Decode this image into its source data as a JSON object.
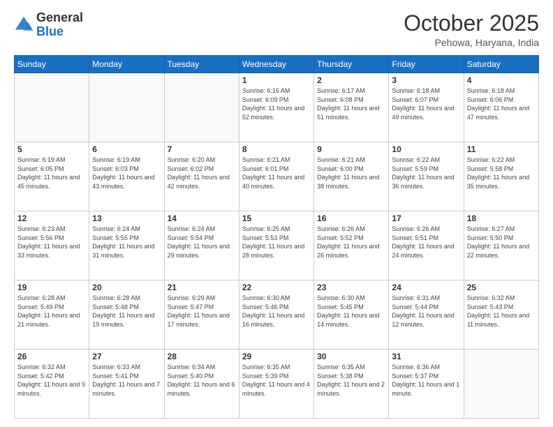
{
  "header": {
    "logo_general": "General",
    "logo_blue": "Blue",
    "month_title": "October 2025",
    "location": "Pehowa, Haryana, India"
  },
  "weekdays": [
    "Sunday",
    "Monday",
    "Tuesday",
    "Wednesday",
    "Thursday",
    "Friday",
    "Saturday"
  ],
  "weeks": [
    [
      {
        "day": "",
        "sunrise": "",
        "sunset": "",
        "daylight": ""
      },
      {
        "day": "",
        "sunrise": "",
        "sunset": "",
        "daylight": ""
      },
      {
        "day": "",
        "sunrise": "",
        "sunset": "",
        "daylight": ""
      },
      {
        "day": "1",
        "sunrise": "Sunrise: 6:16 AM",
        "sunset": "Sunset: 6:09 PM",
        "daylight": "Daylight: 11 hours and 52 minutes."
      },
      {
        "day": "2",
        "sunrise": "Sunrise: 6:17 AM",
        "sunset": "Sunset: 6:08 PM",
        "daylight": "Daylight: 11 hours and 51 minutes."
      },
      {
        "day": "3",
        "sunrise": "Sunrise: 6:18 AM",
        "sunset": "Sunset: 6:07 PM",
        "daylight": "Daylight: 11 hours and 49 minutes."
      },
      {
        "day": "4",
        "sunrise": "Sunrise: 6:18 AM",
        "sunset": "Sunset: 6:06 PM",
        "daylight": "Daylight: 11 hours and 47 minutes."
      }
    ],
    [
      {
        "day": "5",
        "sunrise": "Sunrise: 6:19 AM",
        "sunset": "Sunset: 6:05 PM",
        "daylight": "Daylight: 11 hours and 45 minutes."
      },
      {
        "day": "6",
        "sunrise": "Sunrise: 6:19 AM",
        "sunset": "Sunset: 6:03 PM",
        "daylight": "Daylight: 11 hours and 43 minutes."
      },
      {
        "day": "7",
        "sunrise": "Sunrise: 6:20 AM",
        "sunset": "Sunset: 6:02 PM",
        "daylight": "Daylight: 11 hours and 42 minutes."
      },
      {
        "day": "8",
        "sunrise": "Sunrise: 6:21 AM",
        "sunset": "Sunset: 6:01 PM",
        "daylight": "Daylight: 11 hours and 40 minutes."
      },
      {
        "day": "9",
        "sunrise": "Sunrise: 6:21 AM",
        "sunset": "Sunset: 6:00 PM",
        "daylight": "Daylight: 11 hours and 38 minutes."
      },
      {
        "day": "10",
        "sunrise": "Sunrise: 6:22 AM",
        "sunset": "Sunset: 5:59 PM",
        "daylight": "Daylight: 11 hours and 36 minutes."
      },
      {
        "day": "11",
        "sunrise": "Sunrise: 6:22 AM",
        "sunset": "Sunset: 5:58 PM",
        "daylight": "Daylight: 11 hours and 35 minutes."
      }
    ],
    [
      {
        "day": "12",
        "sunrise": "Sunrise: 6:23 AM",
        "sunset": "Sunset: 5:56 PM",
        "daylight": "Daylight: 11 hours and 33 minutes."
      },
      {
        "day": "13",
        "sunrise": "Sunrise: 6:24 AM",
        "sunset": "Sunset: 5:55 PM",
        "daylight": "Daylight: 11 hours and 31 minutes."
      },
      {
        "day": "14",
        "sunrise": "Sunrise: 6:24 AM",
        "sunset": "Sunset: 5:54 PM",
        "daylight": "Daylight: 11 hours and 29 minutes."
      },
      {
        "day": "15",
        "sunrise": "Sunrise: 6:25 AM",
        "sunset": "Sunset: 5:53 PM",
        "daylight": "Daylight: 11 hours and 28 minutes."
      },
      {
        "day": "16",
        "sunrise": "Sunrise: 6:26 AM",
        "sunset": "Sunset: 5:52 PM",
        "daylight": "Daylight: 11 hours and 26 minutes."
      },
      {
        "day": "17",
        "sunrise": "Sunrise: 6:26 AM",
        "sunset": "Sunset: 5:51 PM",
        "daylight": "Daylight: 11 hours and 24 minutes."
      },
      {
        "day": "18",
        "sunrise": "Sunrise: 6:27 AM",
        "sunset": "Sunset: 5:50 PM",
        "daylight": "Daylight: 11 hours and 22 minutes."
      }
    ],
    [
      {
        "day": "19",
        "sunrise": "Sunrise: 6:28 AM",
        "sunset": "Sunset: 5:49 PM",
        "daylight": "Daylight: 11 hours and 21 minutes."
      },
      {
        "day": "20",
        "sunrise": "Sunrise: 6:28 AM",
        "sunset": "Sunset: 5:48 PM",
        "daylight": "Daylight: 11 hours and 19 minutes."
      },
      {
        "day": "21",
        "sunrise": "Sunrise: 6:29 AM",
        "sunset": "Sunset: 5:47 PM",
        "daylight": "Daylight: 11 hours and 17 minutes."
      },
      {
        "day": "22",
        "sunrise": "Sunrise: 6:30 AM",
        "sunset": "Sunset: 5:46 PM",
        "daylight": "Daylight: 11 hours and 16 minutes."
      },
      {
        "day": "23",
        "sunrise": "Sunrise: 6:30 AM",
        "sunset": "Sunset: 5:45 PM",
        "daylight": "Daylight: 11 hours and 14 minutes."
      },
      {
        "day": "24",
        "sunrise": "Sunrise: 6:31 AM",
        "sunset": "Sunset: 5:44 PM",
        "daylight": "Daylight: 11 hours and 12 minutes."
      },
      {
        "day": "25",
        "sunrise": "Sunrise: 6:32 AM",
        "sunset": "Sunset: 5:43 PM",
        "daylight": "Daylight: 11 hours and 11 minutes."
      }
    ],
    [
      {
        "day": "26",
        "sunrise": "Sunrise: 6:32 AM",
        "sunset": "Sunset: 5:42 PM",
        "daylight": "Daylight: 11 hours and 9 minutes."
      },
      {
        "day": "27",
        "sunrise": "Sunrise: 6:33 AM",
        "sunset": "Sunset: 5:41 PM",
        "daylight": "Daylight: 11 hours and 7 minutes."
      },
      {
        "day": "28",
        "sunrise": "Sunrise: 6:34 AM",
        "sunset": "Sunset: 5:40 PM",
        "daylight": "Daylight: 11 hours and 6 minutes."
      },
      {
        "day": "29",
        "sunrise": "Sunrise: 6:35 AM",
        "sunset": "Sunset: 5:39 PM",
        "daylight": "Daylight: 11 hours and 4 minutes."
      },
      {
        "day": "30",
        "sunrise": "Sunrise: 6:35 AM",
        "sunset": "Sunset: 5:38 PM",
        "daylight": "Daylight: 11 hours and 2 minutes."
      },
      {
        "day": "31",
        "sunrise": "Sunrise: 6:36 AM",
        "sunset": "Sunset: 5:37 PM",
        "daylight": "Daylight: 11 hours and 1 minute."
      },
      {
        "day": "",
        "sunrise": "",
        "sunset": "",
        "daylight": ""
      }
    ]
  ]
}
